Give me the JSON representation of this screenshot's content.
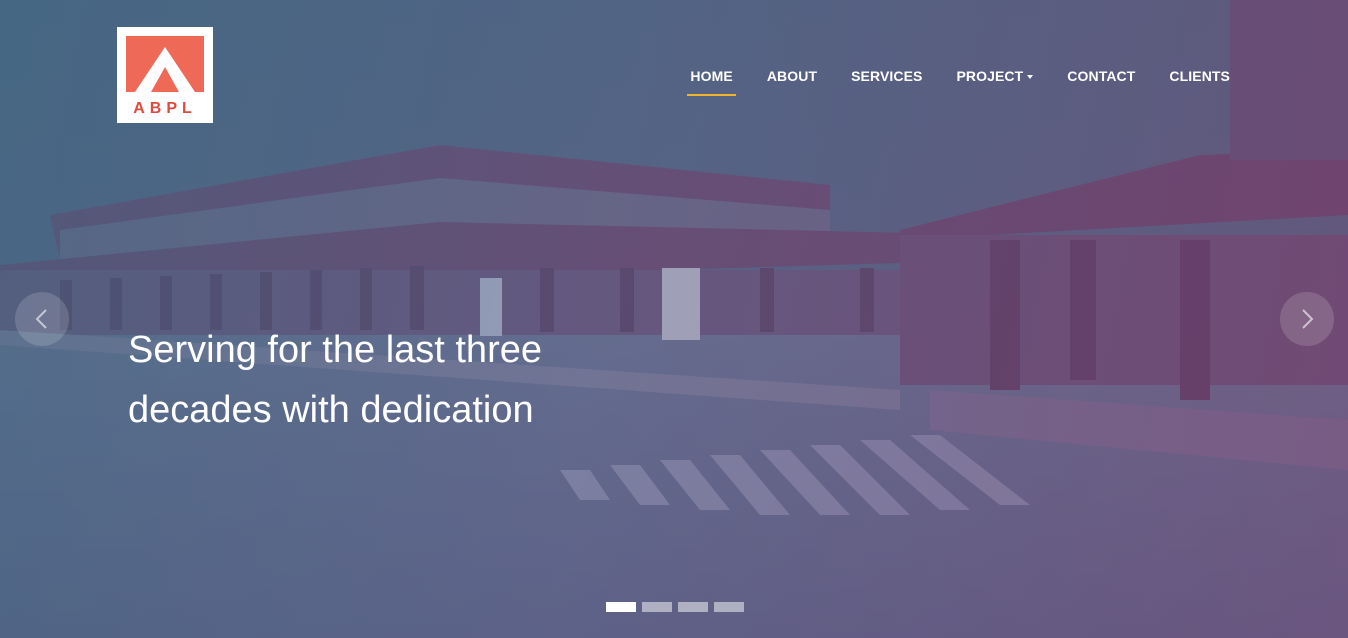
{
  "logo": {
    "text": "ABPL",
    "accent": "#ee6a56"
  },
  "nav": {
    "items": [
      {
        "label": "HOME",
        "active": true
      },
      {
        "label": "ABOUT"
      },
      {
        "label": "SERVICES"
      },
      {
        "label": "PROJECT",
        "dropdown": true
      },
      {
        "label": "CONTACT"
      },
      {
        "label": "CLIENTS"
      }
    ],
    "active_color": "#f0b32e"
  },
  "hero": {
    "headline_line1": "Serving for the last three",
    "headline_line2": "decades with dedication",
    "prev_icon": "chevron-left-icon",
    "next_icon": "chevron-right-icon"
  },
  "carousel": {
    "slide_count": 4,
    "active_index": 0
  }
}
